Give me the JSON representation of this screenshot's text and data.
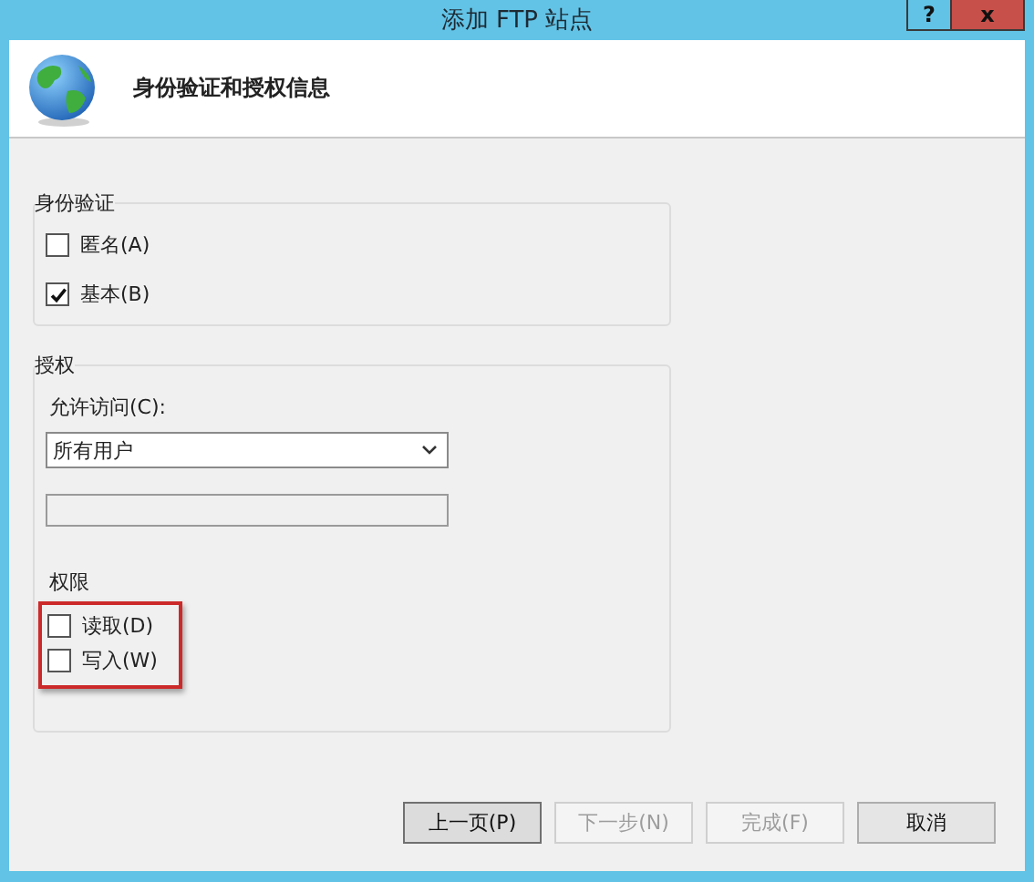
{
  "window": {
    "title": "添加 FTP 站点",
    "help_button": "?",
    "close_button": "x"
  },
  "header": {
    "title": "身份验证和授权信息"
  },
  "authentication": {
    "label": "身份验证",
    "options": [
      {
        "label": "匿名(A)",
        "checked": false
      },
      {
        "label": "基本(B)",
        "checked": true
      }
    ]
  },
  "authorization": {
    "label": "授权",
    "allow_access_label": "允许访问(C):",
    "allow_access": {
      "value": "所有用户"
    },
    "permissions_label": "权限",
    "permissions_highlighted": true,
    "permissions": [
      {
        "label": "读取(D)",
        "checked": false
      },
      {
        "label": "写入(W)",
        "checked": false
      }
    ]
  },
  "buttons": [
    {
      "label": "上一页(P)",
      "disabled": false,
      "focused": true
    },
    {
      "label": "下一步(N)",
      "disabled": true,
      "focused": false
    },
    {
      "label": "完成(F)",
      "disabled": true,
      "focused": false
    },
    {
      "label": "取消",
      "disabled": false,
      "focused": false
    }
  ]
}
